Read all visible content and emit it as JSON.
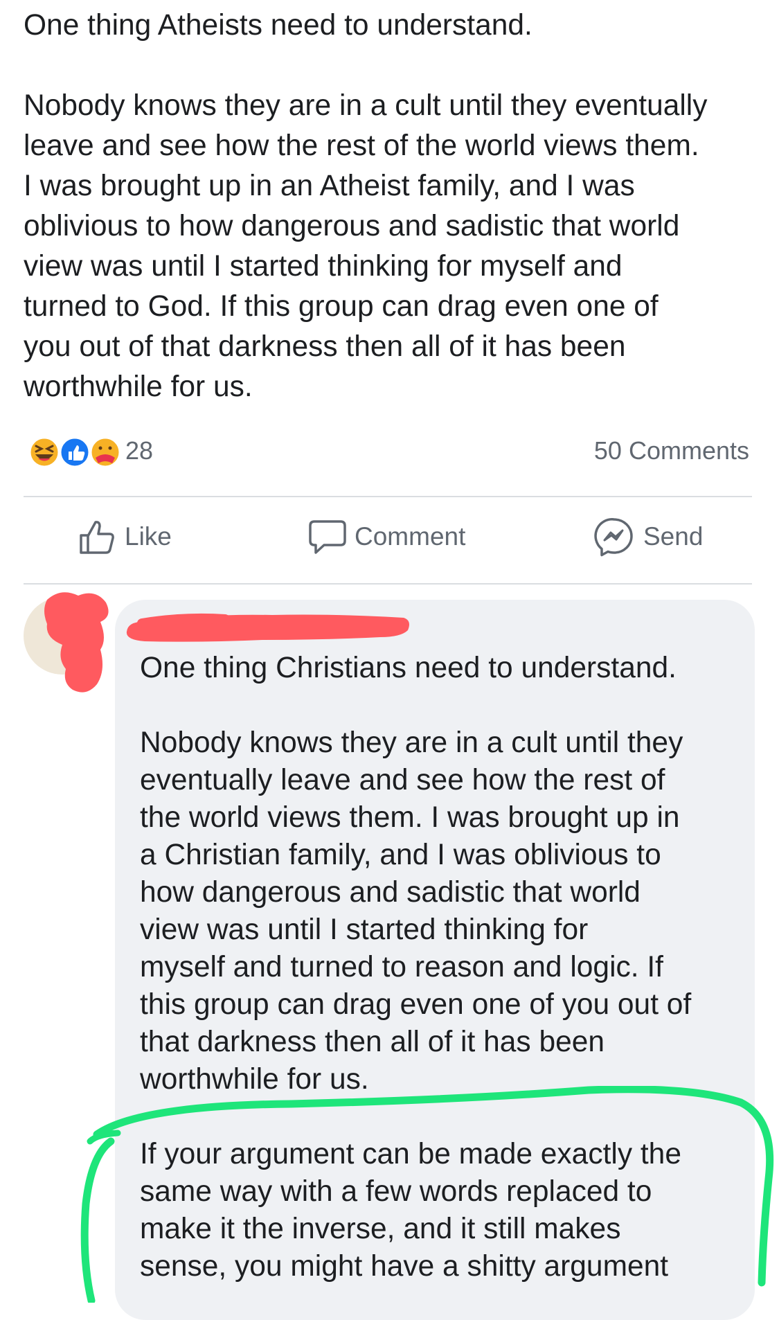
{
  "post": {
    "lines": [
      "One thing Atheists need to understand.",
      "Nobody knows they are in a cult until they eventually",
      "leave and see how the rest of the world views them.",
      "I was brought up in an Atheist family, and I was",
      "oblivious to how dangerous and sadistic that world",
      "view was until I started thinking for myself and",
      "turned to God. If this group can drag even one of",
      "you out of that darkness then all of it has been",
      "worthwhile for us."
    ]
  },
  "reactions": {
    "icons": [
      "laughing-emoji-icon",
      "like-reaction-icon",
      "care-reaction-icon"
    ],
    "count": "28",
    "comments": "50 Comments"
  },
  "actions": {
    "like": "Like",
    "comment": "Comment",
    "send": "Send"
  },
  "comment": {
    "lines": [
      "One thing Christians need to understand.",
      "Nobody knows they are in a cult until they",
      "eventually leave and see how the rest of",
      "the world views them. I was brought up in",
      "a Christian family, and I was oblivious to",
      "how dangerous and sadistic that world",
      "view was until I started thinking for",
      "myself and turned to reason and logic. If",
      "this group can drag even one of you out of",
      "that darkness then all of it has been",
      "worthwhile for us.",
      "If your argument can be made exactly the",
      "same way with a few words replaced to",
      "make it the inverse, and it still makes",
      "sense, you might have a shitty argument"
    ]
  },
  "colors": {
    "redaction": "#ff5a5f",
    "highlight": "#1ee57a",
    "bubble": "#eff1f4",
    "secondary_text": "#606770",
    "like_blue": "#1877f2"
  }
}
